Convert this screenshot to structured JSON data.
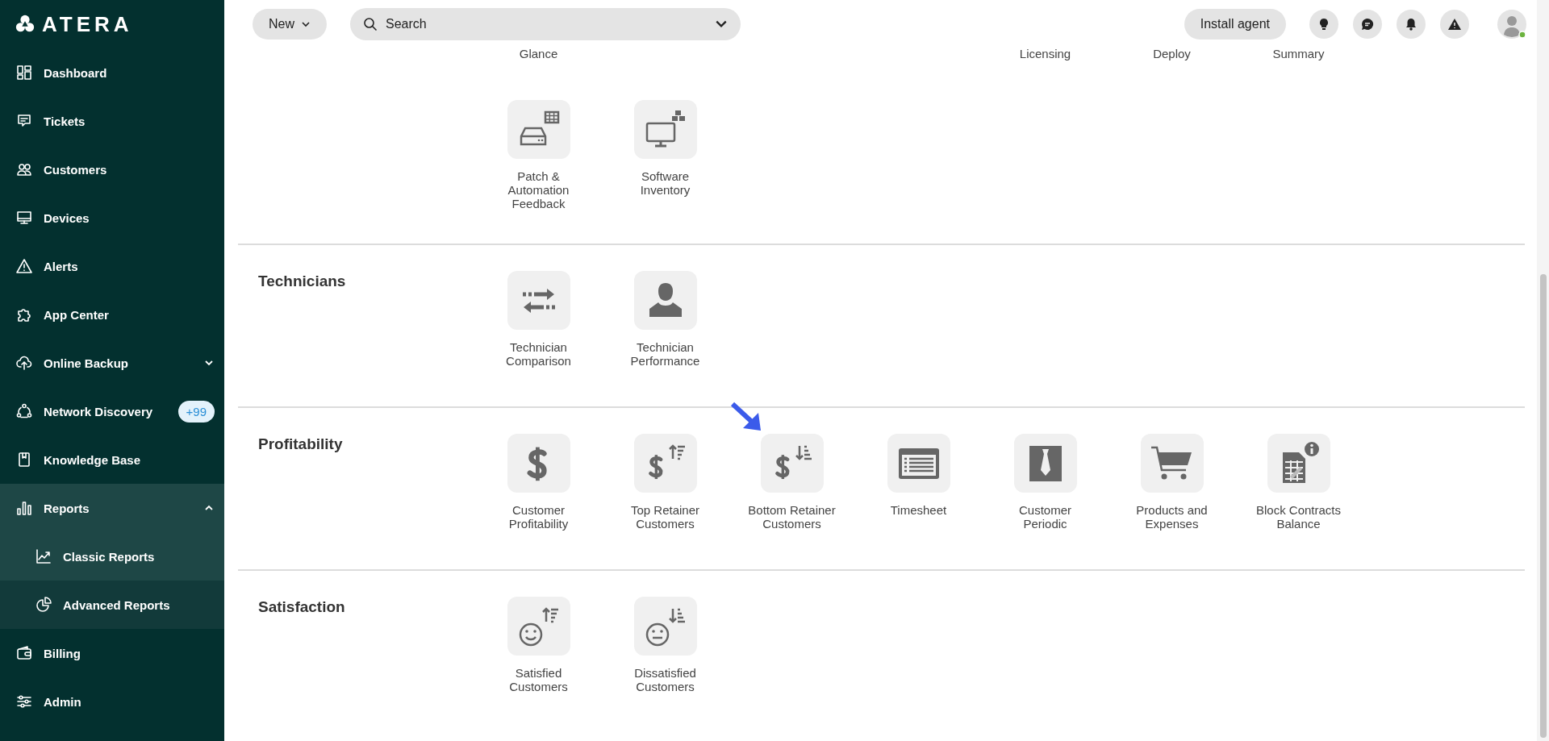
{
  "sidebar": {
    "logo": "ATERA",
    "items": [
      {
        "label": "Dashboard",
        "selected": false
      },
      {
        "label": "Tickets",
        "selected": false
      },
      {
        "label": "Customers",
        "selected": false
      },
      {
        "label": "Devices",
        "selected": false
      },
      {
        "label": "Alerts",
        "selected": false
      },
      {
        "label": "App Center",
        "selected": false
      },
      {
        "label": "Online Backup",
        "selected": false,
        "expanded": false
      },
      {
        "label": "Network Discovery",
        "selected": false,
        "badge": "+99"
      },
      {
        "label": "Knowledge Base",
        "selected": false
      },
      {
        "label": "Reports",
        "selected": false,
        "expanded": true,
        "children": [
          {
            "label": "Classic Reports",
            "selected": true
          },
          {
            "label": "Advanced Reports",
            "selected": false
          }
        ]
      },
      {
        "label": "Billing",
        "selected": false
      },
      {
        "label": "Admin",
        "selected": false
      }
    ]
  },
  "top_bar": {
    "new_button": "New",
    "search": {
      "placeholder": "Search"
    },
    "install_button": "Install agent"
  },
  "sections": [
    {
      "items": [
        {
          "kind": "cut",
          "label": "Glance"
        },
        {
          "kind": "gap"
        },
        {
          "kind": "gap"
        },
        {
          "kind": "gap"
        },
        {
          "kind": "cut",
          "label": "Licensing"
        },
        {
          "kind": "cut",
          "label": "Deploy"
        },
        {
          "kind": "cut",
          "label": "Summary"
        },
        {
          "kind": "report",
          "label": "Patch &\nAutomation\nFeedback"
        },
        {
          "kind": "report",
          "label": "Software\nInventory"
        }
      ]
    },
    {
      "title": "Technicians",
      "items": [
        {
          "kind": "report",
          "label": "Technician\nComparison"
        },
        {
          "kind": "report",
          "label": "Technician\nPerformance"
        }
      ]
    },
    {
      "title": "Profitability",
      "items": [
        {
          "kind": "report",
          "label": "Customer\nProfitability"
        },
        {
          "kind": "report",
          "label": "Top Retainer\nCustomers"
        },
        {
          "kind": "report",
          "label": "Bottom Retainer\nCustomers"
        },
        {
          "kind": "report",
          "label": "Timesheet"
        },
        {
          "kind": "report",
          "label": "Customer\nPeriodic"
        },
        {
          "kind": "report",
          "label": "Products and\nExpenses"
        },
        {
          "kind": "report",
          "label": "Block Contracts\nBalance"
        }
      ]
    },
    {
      "title": "Satisfaction",
      "items": [
        {
          "kind": "report",
          "label": "Satisfied\nCustomers"
        },
        {
          "kind": "report",
          "label": "Dissatisfied\nCustomers"
        }
      ]
    }
  ]
}
